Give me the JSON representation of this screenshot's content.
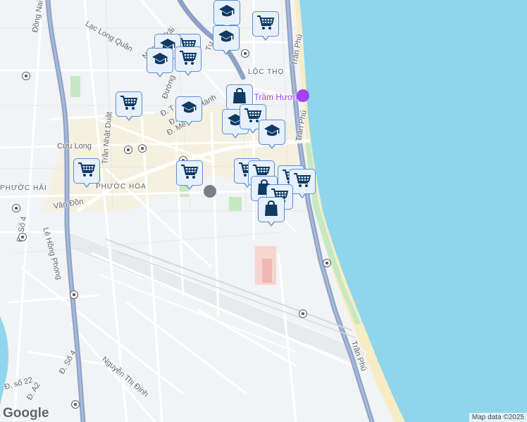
{
  "map": {
    "attribution": "Map data ©2025",
    "logo": "Google",
    "colors": {
      "sea": "#8fd6ec",
      "land": "#f1f3f4",
      "highway": "#8ea2c7",
      "road": "#ffffff",
      "park": "#c6e8c3",
      "marker_bg": "#e8f0fe",
      "marker_border": "#5b8fd9",
      "marker_icon": "#0f3a63"
    },
    "labels": [
      {
        "id": "dong-nai",
        "text": "Đồng Nai",
        "cls": "road",
        "rot": -80
      },
      {
        "id": "nguyen-trai",
        "text": "Nguyễn Trãi",
        "cls": "road",
        "rot": -45
      },
      {
        "id": "lac-long-quan",
        "text": "Lạc Long Quân",
        "cls": "road",
        "rot": 30
      },
      {
        "id": "tu",
        "text": "Tự",
        "cls": "road",
        "rot": -70
      },
      {
        "id": "duong",
        "text": "Đường",
        "cls": "road",
        "rot": -70
      },
      {
        "id": "loc-tho",
        "text": "LỘC THỌ",
        "cls": "district",
        "rot": 0
      },
      {
        "id": "tran-phu-1",
        "text": "Trần Phú",
        "cls": "road",
        "rot": -80
      },
      {
        "id": "than-hai-huong",
        "text": "Tháp Trầm Hương",
        "cls": "poi",
        "rot": 0
      },
      {
        "id": "tran-phu-2",
        "text": "Trần Phú",
        "cls": "road",
        "rot": -80
      },
      {
        "id": "tran-nhat-duat",
        "text": "Trần Nhật Duật",
        "cls": "road",
        "rot": -85
      },
      {
        "id": "le-dai-hanh",
        "text": "Đ. Lê Đại Hành",
        "cls": "road",
        "rot": -30
      },
      {
        "id": "me-linh",
        "text": "Đ. Mê Linh",
        "cls": "road",
        "rot": -30
      },
      {
        "id": "d-t",
        "text": "Đ. T",
        "cls": "road",
        "rot": -30
      },
      {
        "id": "cuu-long",
        "text": "Cửu Long",
        "cls": "road",
        "rot": 0
      },
      {
        "id": "phuoc-hai",
        "text": "PHƯỚC HẢI",
        "cls": "district",
        "rot": 0
      },
      {
        "id": "phuoc-hoa",
        "text": "PHƯỚC HÒA",
        "cls": "district",
        "rot": 0
      },
      {
        "id": "van-don",
        "text": "Vân Đồn",
        "cls": "road",
        "rot": -10
      },
      {
        "id": "d-so-4-a",
        "text": "Đ. Số 4",
        "cls": "road",
        "rot": -80
      },
      {
        "id": "le-hong-phong",
        "text": "Lê Hồng Phong",
        "cls": "road",
        "rot": 75
      },
      {
        "id": "tran-phu-3",
        "text": "Trần Phú",
        "cls": "road",
        "rot": 70
      },
      {
        "id": "nguyen-thi-dinh",
        "text": "Nguyễn Thị Định",
        "cls": "road",
        "rot": 40
      },
      {
        "id": "d-so-22",
        "text": "Đ. số 22",
        "cls": "road",
        "rot": -15
      },
      {
        "id": "d-so-4-b",
        "text": "Đ. Số 4",
        "cls": "road",
        "rot": -60
      },
      {
        "id": "d-a2",
        "text": "Đ. A2",
        "cls": "road",
        "rot": -60
      }
    ],
    "markers": [
      {
        "type": "graduation-cap"
      },
      {
        "type": "shopping-cart"
      },
      {
        "type": "graduation-cap"
      },
      {
        "type": "shopping-cart"
      },
      {
        "type": "graduation-cap"
      },
      {
        "type": "shopping-cart"
      },
      {
        "type": "graduation-cap"
      },
      {
        "type": "shopping-cart"
      },
      {
        "type": "graduation-cap"
      },
      {
        "type": "shopping-bag"
      },
      {
        "type": "graduation-cap"
      },
      {
        "type": "shopping-cart"
      },
      {
        "type": "graduation-cap"
      },
      {
        "type": "shopping-cart"
      },
      {
        "type": "shopping-cart"
      },
      {
        "type": "shopping-cart"
      },
      {
        "type": "shopping-cart"
      },
      {
        "type": "shopping-cart"
      },
      {
        "type": "shopping-cart"
      },
      {
        "type": "shopping-bag"
      },
      {
        "type": "shopping-cart"
      },
      {
        "type": "shopping-bag"
      }
    ]
  }
}
